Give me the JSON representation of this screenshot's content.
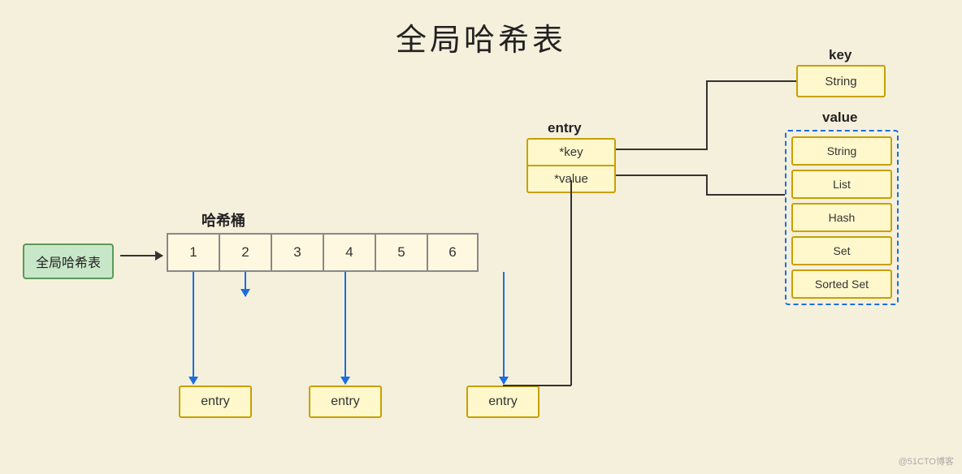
{
  "title": "全局哈希表",
  "global_ht_label": "全局哈希表",
  "bucket_label": "哈希桶",
  "buckets": [
    "1",
    "2",
    "3",
    "4",
    "5",
    "6"
  ],
  "entry_detail_label": "entry",
  "entry_detail_rows": [
    "*key",
    "*value"
  ],
  "entry_bottom": [
    "entry",
    "entry",
    "entry"
  ],
  "key_label": "key",
  "key_type": "String",
  "value_label": "value",
  "value_types": [
    "String",
    "List",
    "Hash",
    "Set",
    "Sorted Set"
  ],
  "watermark": "@51CTO博客"
}
